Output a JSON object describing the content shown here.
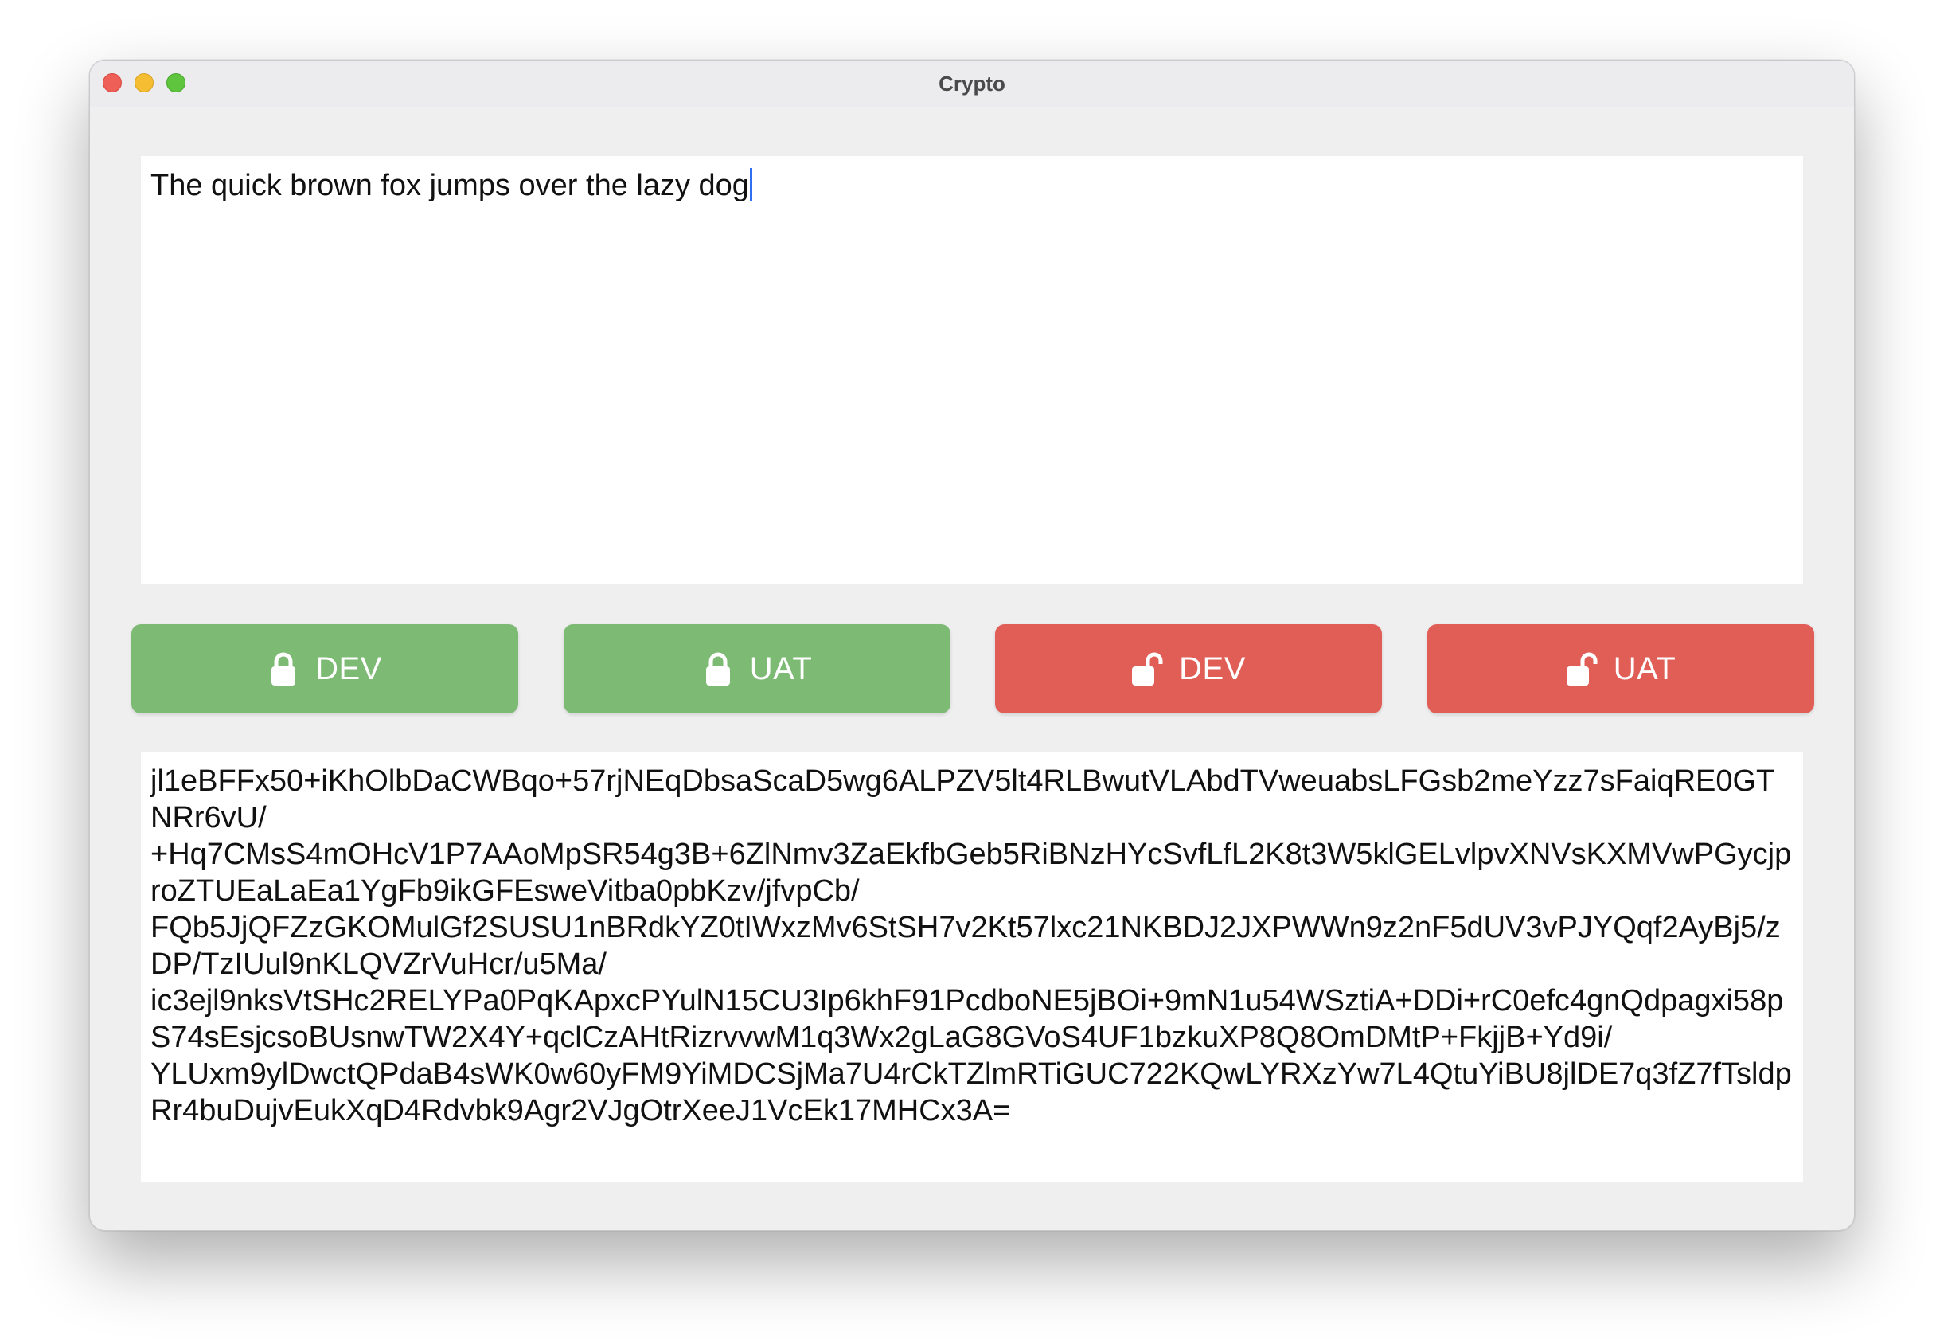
{
  "window": {
    "title": "Crypto"
  },
  "input": {
    "value": "The quick brown fox jumps over the lazy dog"
  },
  "buttons": [
    {
      "label": "DEV",
      "icon": "lock-icon",
      "color": "#7dba74"
    },
    {
      "label": "UAT",
      "icon": "lock-icon",
      "color": "#7dba74"
    },
    {
      "label": "DEV",
      "icon": "unlock-icon",
      "color": "#e05e55"
    },
    {
      "label": "UAT",
      "icon": "unlock-icon",
      "color": "#e05e55"
    }
  ],
  "output": {
    "value": "jl1eBFFx50+iKhOlbDaCWBqo+57rjNEqDbsaScaD5wg6ALPZV5lt4RLBwutVLAbdTVweuabsLFGsb2meYzz7sFaiqRE0GTNRr6vU/\n+Hq7CMsS4mOHcV1P7AAoMpSR54g3B+6ZlNmv3ZaEkfbGeb5RiBNzHYcSvfLfL2K8t3W5klGELvlpvXNVsKXMVwPGycjproZTUEaLaEa1YgFb9ikGFEsweVitba0pbKzv/jfvpCb/\nFQb5JjQFZzGKOMulGf2SUSU1nBRdkYZ0tIWxzMv6StSH7v2Kt57lxc21NKBDJ2JXPWWn9z2nF5dUV3vPJYQqf2AyBj5/zDP/TzIUul9nKLQVZrVuHcr/u5Ma/\nic3ejl9nksVtSHc2RELYPa0PqKApxcPYulN15CU3Ip6khF91PcdboNE5jBOi+9mN1u54WSztiA+DDi+rC0efc4gnQdpagxi58pS74sEsjcsoBUsnwTW2X4Y+qclCzAHtRizrvvwM1q3Wx2gLaG8GVoS4UF1bzkuXP8Q8OmDMtP+FkjjB+Yd9i/\nYLUxm9ylDwctQPdaB4sWK0w60yFM9YiMDCSjMa7U4rCkTZlmRTiGUC722KQwLYRXzYw7L4QtuYiBU8jlDE7q3fZ7fTsldpRr4buDujvEukXqD4Rdvbk9Agr2VJgOtrXeeJ1VcEk17MHCx3A="
  }
}
